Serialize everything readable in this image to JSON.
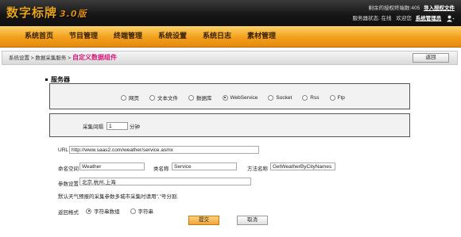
{
  "header": {
    "logo_main": "数字标牌",
    "logo_sub": "3.0版",
    "license_text": "剩余的授权终端数:405",
    "import_license_link": "导入授权文件",
    "server_status_label": "服务器状态: 在线",
    "welcome_label": "欢迎您",
    "user_link": "系统管理员",
    "user_icon": "user-icon"
  },
  "nav": {
    "items": [
      "系统首页",
      "节目管理",
      "终端管理",
      "系统设置",
      "系统日志",
      "素材管理"
    ]
  },
  "breadcrumb": {
    "path": "系统设置 > 数据采集服务 >",
    "current": "自定义数据组件"
  },
  "back_button": "返回",
  "section_title": "服务器",
  "server_types": {
    "options": [
      "网页",
      "文本文件",
      "数据库",
      "WebService",
      "Socket",
      "Rss",
      "Ftp"
    ],
    "selected": "WebService"
  },
  "interval": {
    "label": "采集间隔",
    "value": "1",
    "unit": "分钟"
  },
  "form": {
    "url_label": "URL",
    "url_value": "http://www.saas2.com/weather/service.asmx",
    "namespace_label": "命名空间",
    "namespace_value": "Weather",
    "class_label": "类名称",
    "class_value": "Service",
    "method_label": "方法名称",
    "method_value": "GetWeatherByCityNames",
    "params_label": "参数设置",
    "params_value": "北京,杭州,上海",
    "note": "默认天气预报的采集参数多城市采集时请用\",\"号分割.",
    "return_label": "返回格式",
    "return_options": [
      "字符串数组",
      "字符串"
    ],
    "return_selected": "字符串数组"
  },
  "buttons": {
    "submit": "提交",
    "cancel": "取消"
  },
  "colors": {
    "nav_orange": "#f29f1b",
    "logo_gold": "#e7a51b",
    "breadcrumb_current": "#d8177c"
  }
}
